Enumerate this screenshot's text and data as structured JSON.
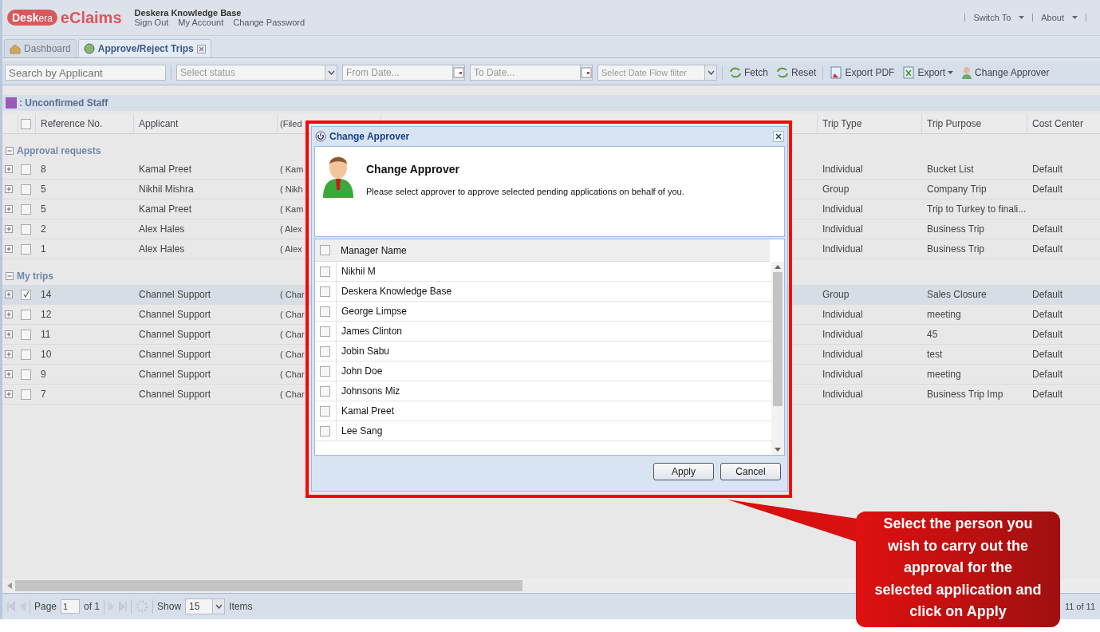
{
  "header": {
    "logo_prefix": "Desk",
    "logo_suffix": "era",
    "product": "eClaims",
    "company": "Deskera Knowledge Base",
    "links": [
      "Sign Out",
      "My Account",
      "Change Password"
    ],
    "menus": [
      "Switch To",
      "About"
    ]
  },
  "tabs": [
    {
      "label": "Dashboard",
      "selected": false,
      "closable": false
    },
    {
      "label": "Approve/Reject Trips",
      "selected": true,
      "closable": true
    }
  ],
  "toolbar": {
    "search": {
      "placeholder": "Search by Applicant"
    },
    "status": {
      "placeholder": "Select status"
    },
    "from_date": {
      "placeholder": "From Date..."
    },
    "to_date": {
      "placeholder": "To Date..."
    },
    "date_flow": {
      "placeholder": "Select Date Flow filter"
    },
    "buttons": [
      {
        "kind": "fetch",
        "label": "Fetch"
      },
      {
        "kind": "reset",
        "label": "Reset"
      },
      {
        "kind": "pdf",
        "label": "Export PDF"
      },
      {
        "kind": "export",
        "label": "Export"
      },
      {
        "kind": "approver",
        "label": "Change Approver"
      }
    ]
  },
  "legend": {
    "label": ": Unconfirmed Staff",
    "color": "#9b59b6"
  },
  "table": {
    "header_checked": false,
    "columns": [
      "Reference No.",
      "Applicant",
      "(Filed",
      "Trip Type",
      "Trip Purpose",
      "Cost Center"
    ],
    "groups": [
      {
        "title": "Approval requests",
        "expanded": true,
        "rows": [
          {
            "ref": "8",
            "applicant": "Kamal Preet",
            "filed_by": "( Kam",
            "trip_type": "Individual",
            "purpose": "Bucket List",
            "cost_center": "Default",
            "checked": false
          },
          {
            "ref": "5",
            "applicant": "Nikhil Mishra",
            "filed_by": "( Nikh",
            "trip_type": "Group",
            "purpose": "Company Trip",
            "cost_center": "Default",
            "checked": false
          },
          {
            "ref": "5",
            "applicant": "Kamal Preet",
            "filed_by": "( Kam",
            "trip_type": "Individual",
            "purpose": "Trip to Turkey to finali...",
            "cost_center": "",
            "checked": false
          },
          {
            "ref": "2",
            "applicant": "Alex Hales",
            "filed_by": "( Alex",
            "trip_type": "Individual",
            "purpose": "Business Trip",
            "cost_center": "Default",
            "checked": false
          },
          {
            "ref": "1",
            "applicant": "Alex Hales",
            "filed_by": "( Alex",
            "trip_type": "Individual",
            "purpose": "Business Trip",
            "cost_center": "Default",
            "checked": false
          }
        ]
      },
      {
        "title": "My trips",
        "expanded": true,
        "rows": [
          {
            "ref": "14",
            "applicant": "Channel Support",
            "filed_by": "( Char",
            "trip_type": "Group",
            "purpose": "Sales Closure",
            "cost_center": "Default",
            "checked": true
          },
          {
            "ref": "12",
            "applicant": "Channel Support",
            "filed_by": "( Char",
            "trip_type": "Individual",
            "purpose": "meeting",
            "cost_center": "Default",
            "checked": false
          },
          {
            "ref": "11",
            "applicant": "Channel Support",
            "filed_by": "( Char",
            "trip_type": "Individual",
            "purpose": "45",
            "cost_center": "Default",
            "checked": false
          },
          {
            "ref": "10",
            "applicant": "Channel Support",
            "filed_by": "( Char",
            "trip_type": "Individual",
            "purpose": "test",
            "cost_center": "Default",
            "checked": false
          },
          {
            "ref": "9",
            "applicant": "Channel Support",
            "filed_by": "( Char",
            "trip_type": "Individual",
            "purpose": "meeting",
            "cost_center": "Default",
            "checked": false
          },
          {
            "ref": "7",
            "applicant": "Channel Support",
            "filed_by": "( Char",
            "trip_type": "Individual",
            "purpose": "Business Trip Imp",
            "cost_center": "Default",
            "checked": false
          }
        ]
      }
    ]
  },
  "pager": {
    "page_label": "Page",
    "page": "1",
    "of": "of 1",
    "show": "Show",
    "page_size": "15",
    "items": "Items",
    "count": "11 of 11"
  },
  "dialog": {
    "title": "Change Approver",
    "heading": "Change Approver",
    "message": "Please select approver to approve selected pending applications on behalf of you.",
    "column": "Manager Name",
    "header_checked": false,
    "managers": [
      {
        "name": "Nikhil M",
        "checked": false
      },
      {
        "name": "Deskera Knowledge Base",
        "checked": false
      },
      {
        "name": "George Limpse",
        "checked": false
      },
      {
        "name": "James Clinton",
        "checked": false
      },
      {
        "name": "Jobin Sabu",
        "checked": false
      },
      {
        "name": "John Doe",
        "checked": false
      },
      {
        "name": "Johnsons Miz",
        "checked": false
      },
      {
        "name": "Kamal Preet",
        "checked": false
      },
      {
        "name": "Lee Sang",
        "checked": false
      }
    ],
    "buttons": [
      "Apply",
      "Cancel"
    ]
  },
  "callout": {
    "text": "Select the person you wish to carry out the approval for the selected application and click on Apply"
  }
}
